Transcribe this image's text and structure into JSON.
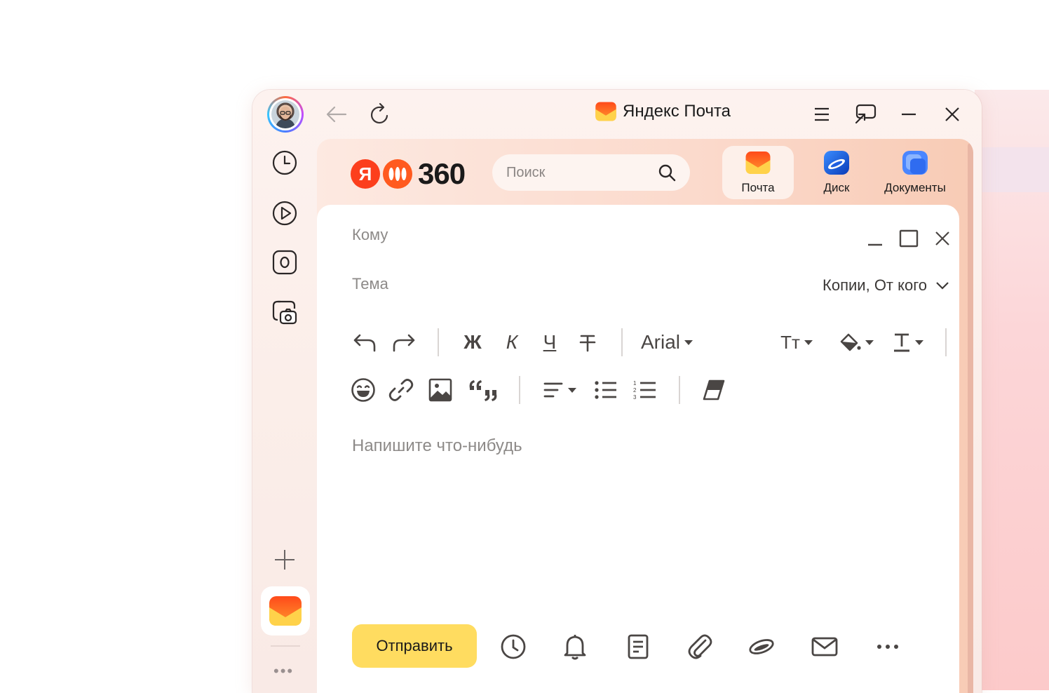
{
  "window": {
    "title": "Яндекс Почта"
  },
  "search": {
    "placeholder": "Поиск"
  },
  "services": [
    {
      "label": "Почта",
      "icon": "mail-icon"
    },
    {
      "label": "Диск",
      "icon": "disk-icon"
    },
    {
      "label": "Документы",
      "icon": "documents-icon"
    }
  ],
  "logo": {
    "ya": "Я",
    "number": "360"
  },
  "compose": {
    "to_label": "Кому",
    "subject_label": "Тема",
    "copies_label": "Копии, От кого",
    "body_placeholder": "Напишите что-нибудь",
    "send_label": "Отправить"
  },
  "toolbar": {
    "bold": "Ж",
    "italic": "К",
    "underline": "Ч",
    "font": "Arial",
    "text_size": "Тт"
  },
  "rail": {
    "more": "•••"
  },
  "colors": {
    "send": "#ffdc60",
    "yandex_red": "#fc3f1d",
    "accent_orange": "#ff5a1f"
  }
}
